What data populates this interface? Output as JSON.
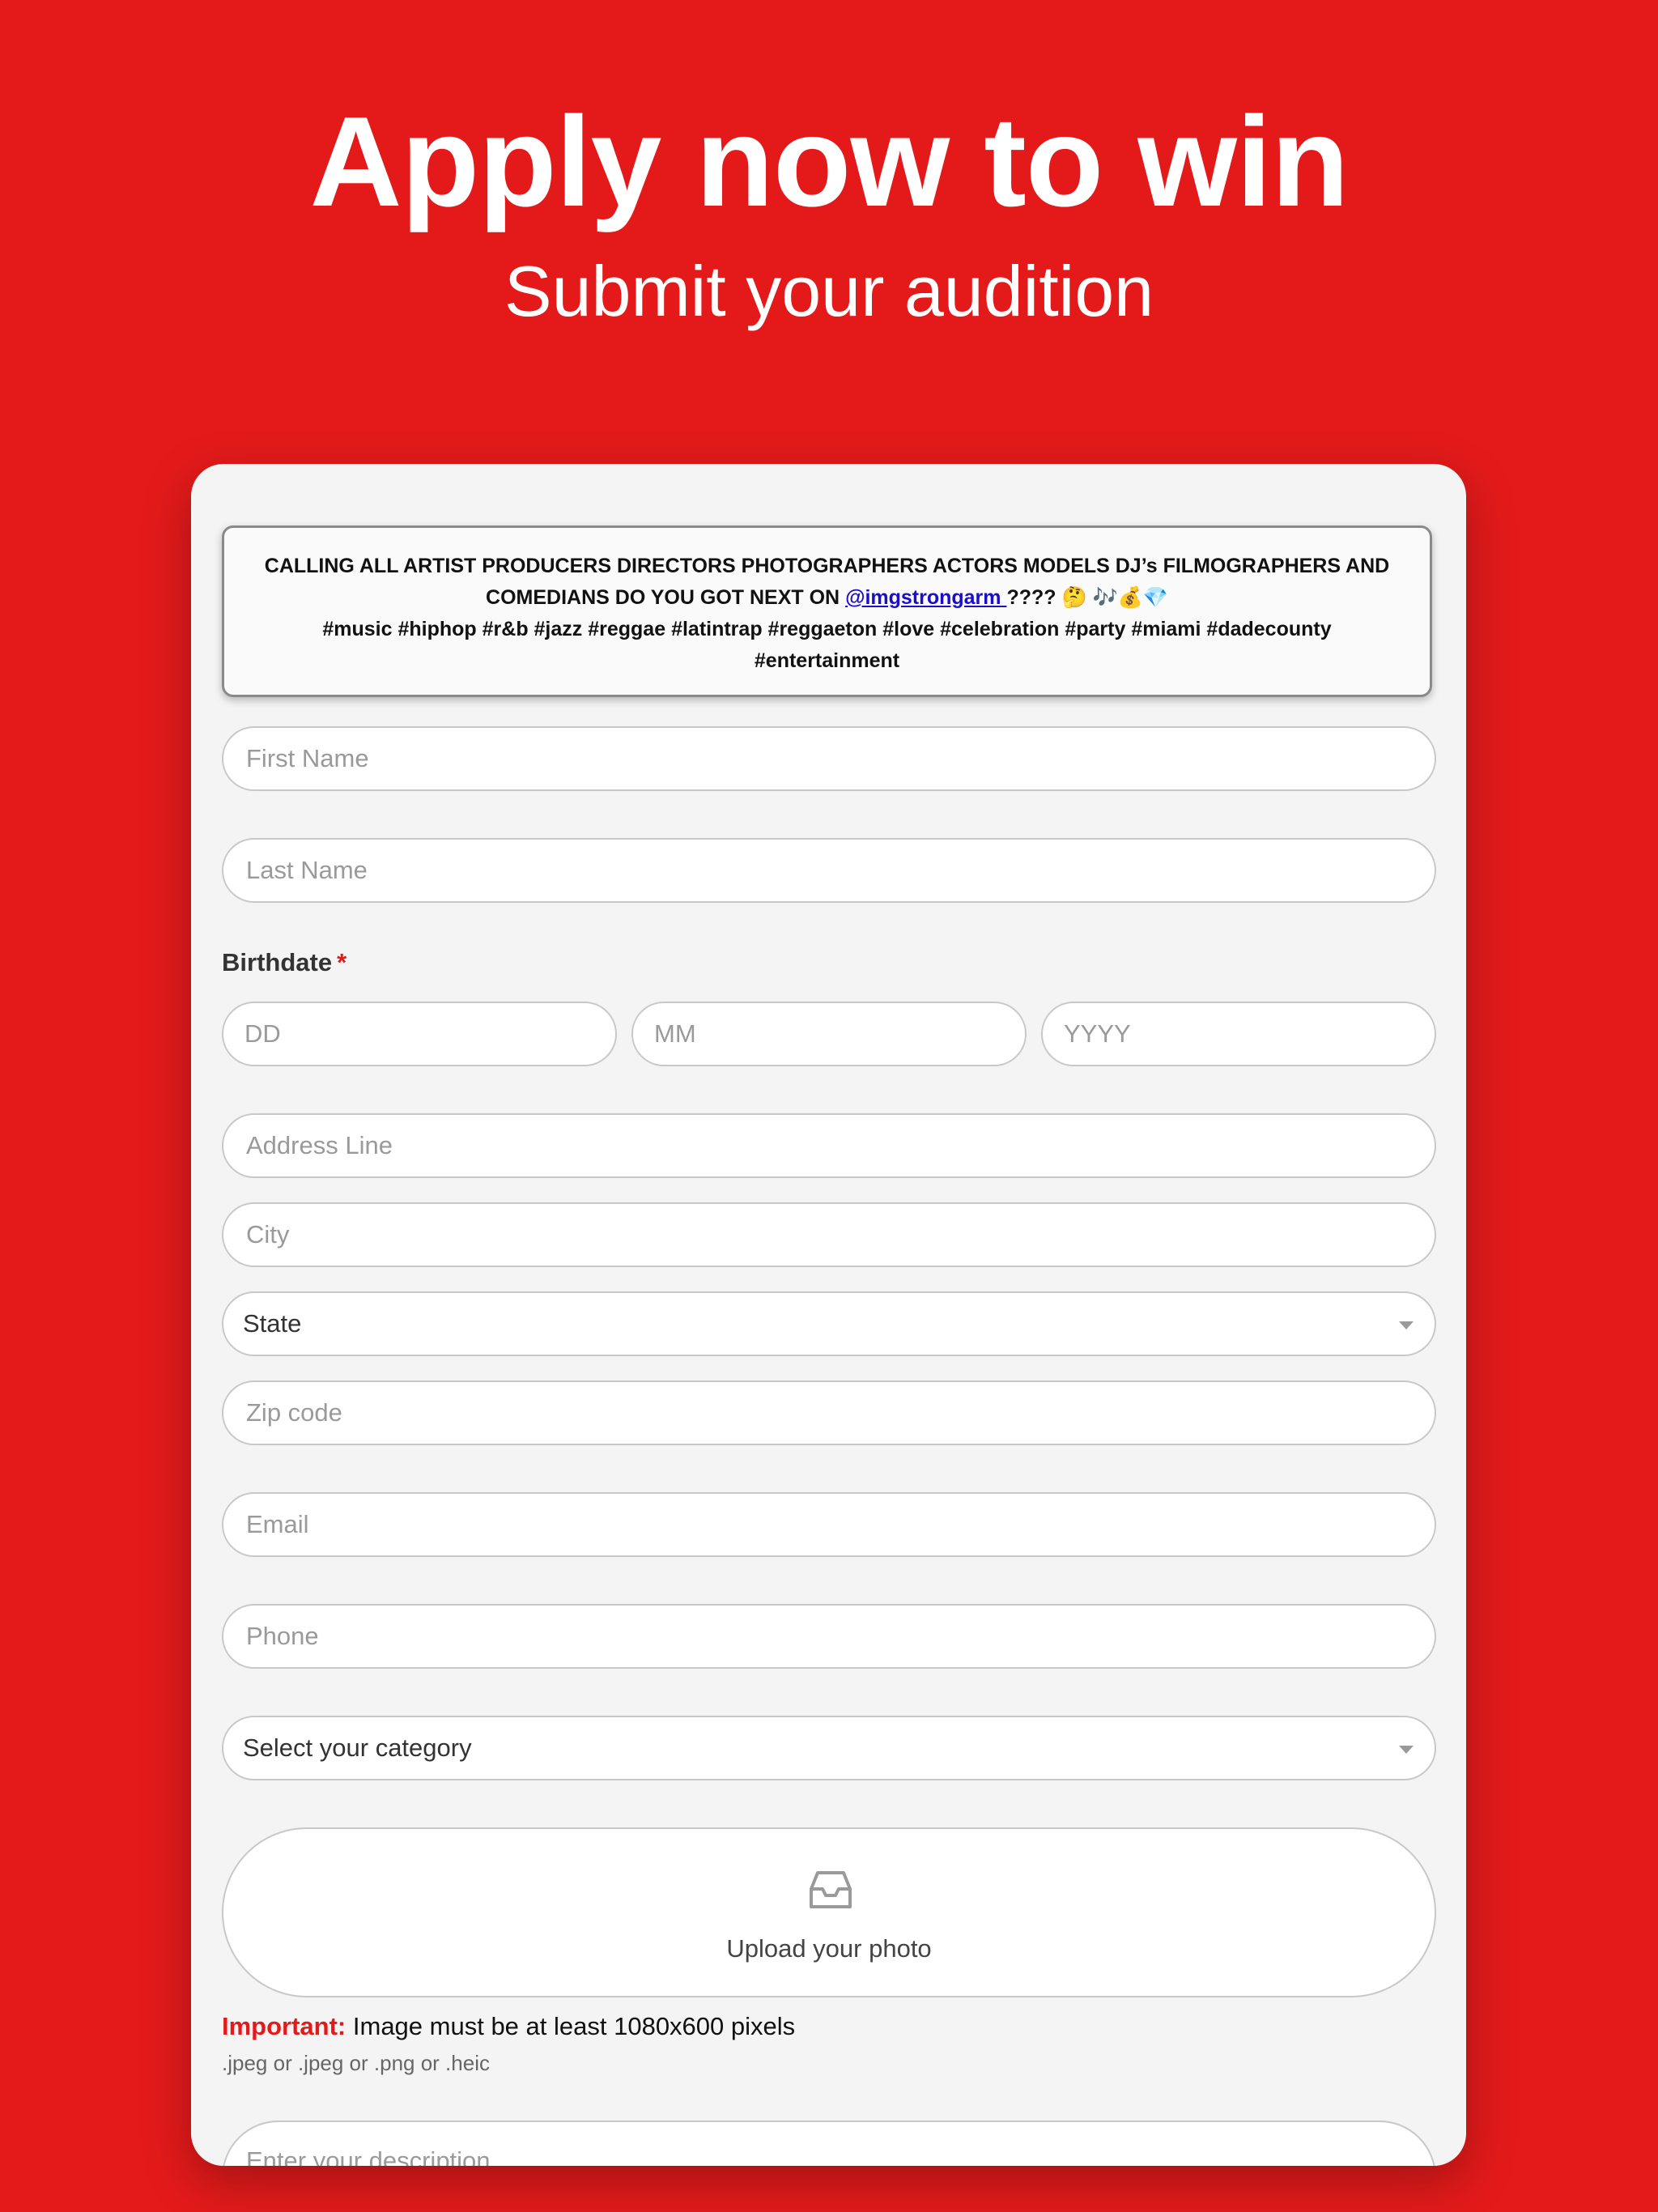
{
  "header": {
    "title": "Apply now to win",
    "subtitle": "Submit your audition"
  },
  "notice": {
    "line1": "CALLING ALL ARTIST PRODUCERS DIRECTORS PHOTOGRAPHERS ACTORS MODELS DJ’s FILMOGRAPHERS AND COMEDIANS DO YOU GOT NEXT ON ",
    "handle": "@imgstrongarm ",
    "after_handle": "????",
    "emojis": " 🤔 🎶💰💎",
    "hashtags": "#music #hiphop #r&b #jazz #reggae #latintrap #reggaeton #love #celebration #party #miami #dadecounty #entertainment"
  },
  "form": {
    "first_name_placeholder": "First Name",
    "last_name_placeholder": "Last Name",
    "birthdate_label": "Birthdate",
    "required_mark": "*",
    "day_placeholder": "DD",
    "month_placeholder": "MM",
    "year_placeholder": "YYYY",
    "address_placeholder": "Address Line",
    "city_placeholder": "City",
    "state_value": "State",
    "zip_placeholder": "Zip code",
    "email_placeholder": "Email",
    "phone_placeholder": "Phone",
    "category_value": "Select your category",
    "upload_label": "Upload your photo",
    "upload_icon": "inbox-tray-icon",
    "important_key": "Important:",
    "important_text": " Image must be at least 1080x600 pixels",
    "formats_text": ".jpeg or .jpeg or .png or .heic",
    "description_placeholder": "Enter your description"
  },
  "colors": {
    "background": "#e41a1a",
    "card": "#f4f4f4",
    "accent_red": "#e41a1a",
    "link": "#1a0dcc"
  }
}
